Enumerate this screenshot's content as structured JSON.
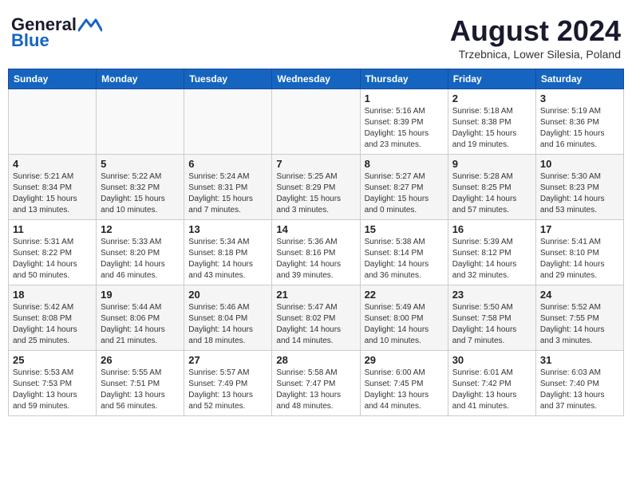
{
  "header": {
    "logo_general": "General",
    "logo_blue": "Blue",
    "month_year": "August 2024",
    "location": "Trzebnica, Lower Silesia, Poland"
  },
  "weekdays": [
    "Sunday",
    "Monday",
    "Tuesday",
    "Wednesday",
    "Thursday",
    "Friday",
    "Saturday"
  ],
  "weeks": [
    [
      {
        "day": "",
        "info": "",
        "empty": true
      },
      {
        "day": "",
        "info": "",
        "empty": true
      },
      {
        "day": "",
        "info": "",
        "empty": true
      },
      {
        "day": "",
        "info": "",
        "empty": true
      },
      {
        "day": "1",
        "info": "Sunrise: 5:16 AM\nSunset: 8:39 PM\nDaylight: 15 hours\nand 23 minutes.",
        "empty": false
      },
      {
        "day": "2",
        "info": "Sunrise: 5:18 AM\nSunset: 8:38 PM\nDaylight: 15 hours\nand 19 minutes.",
        "empty": false
      },
      {
        "day": "3",
        "info": "Sunrise: 5:19 AM\nSunset: 8:36 PM\nDaylight: 15 hours\nand 16 minutes.",
        "empty": false
      }
    ],
    [
      {
        "day": "4",
        "info": "Sunrise: 5:21 AM\nSunset: 8:34 PM\nDaylight: 15 hours\nand 13 minutes.",
        "empty": false
      },
      {
        "day": "5",
        "info": "Sunrise: 5:22 AM\nSunset: 8:32 PM\nDaylight: 15 hours\nand 10 minutes.",
        "empty": false
      },
      {
        "day": "6",
        "info": "Sunrise: 5:24 AM\nSunset: 8:31 PM\nDaylight: 15 hours\nand 7 minutes.",
        "empty": false
      },
      {
        "day": "7",
        "info": "Sunrise: 5:25 AM\nSunset: 8:29 PM\nDaylight: 15 hours\nand 3 minutes.",
        "empty": false
      },
      {
        "day": "8",
        "info": "Sunrise: 5:27 AM\nSunset: 8:27 PM\nDaylight: 15 hours\nand 0 minutes.",
        "empty": false
      },
      {
        "day": "9",
        "info": "Sunrise: 5:28 AM\nSunset: 8:25 PM\nDaylight: 14 hours\nand 57 minutes.",
        "empty": false
      },
      {
        "day": "10",
        "info": "Sunrise: 5:30 AM\nSunset: 8:23 PM\nDaylight: 14 hours\nand 53 minutes.",
        "empty": false
      }
    ],
    [
      {
        "day": "11",
        "info": "Sunrise: 5:31 AM\nSunset: 8:22 PM\nDaylight: 14 hours\nand 50 minutes.",
        "empty": false
      },
      {
        "day": "12",
        "info": "Sunrise: 5:33 AM\nSunset: 8:20 PM\nDaylight: 14 hours\nand 46 minutes.",
        "empty": false
      },
      {
        "day": "13",
        "info": "Sunrise: 5:34 AM\nSunset: 8:18 PM\nDaylight: 14 hours\nand 43 minutes.",
        "empty": false
      },
      {
        "day": "14",
        "info": "Sunrise: 5:36 AM\nSunset: 8:16 PM\nDaylight: 14 hours\nand 39 minutes.",
        "empty": false
      },
      {
        "day": "15",
        "info": "Sunrise: 5:38 AM\nSunset: 8:14 PM\nDaylight: 14 hours\nand 36 minutes.",
        "empty": false
      },
      {
        "day": "16",
        "info": "Sunrise: 5:39 AM\nSunset: 8:12 PM\nDaylight: 14 hours\nand 32 minutes.",
        "empty": false
      },
      {
        "day": "17",
        "info": "Sunrise: 5:41 AM\nSunset: 8:10 PM\nDaylight: 14 hours\nand 29 minutes.",
        "empty": false
      }
    ],
    [
      {
        "day": "18",
        "info": "Sunrise: 5:42 AM\nSunset: 8:08 PM\nDaylight: 14 hours\nand 25 minutes.",
        "empty": false
      },
      {
        "day": "19",
        "info": "Sunrise: 5:44 AM\nSunset: 8:06 PM\nDaylight: 14 hours\nand 21 minutes.",
        "empty": false
      },
      {
        "day": "20",
        "info": "Sunrise: 5:46 AM\nSunset: 8:04 PM\nDaylight: 14 hours\nand 18 minutes.",
        "empty": false
      },
      {
        "day": "21",
        "info": "Sunrise: 5:47 AM\nSunset: 8:02 PM\nDaylight: 14 hours\nand 14 minutes.",
        "empty": false
      },
      {
        "day": "22",
        "info": "Sunrise: 5:49 AM\nSunset: 8:00 PM\nDaylight: 14 hours\nand 10 minutes.",
        "empty": false
      },
      {
        "day": "23",
        "info": "Sunrise: 5:50 AM\nSunset: 7:58 PM\nDaylight: 14 hours\nand 7 minutes.",
        "empty": false
      },
      {
        "day": "24",
        "info": "Sunrise: 5:52 AM\nSunset: 7:55 PM\nDaylight: 14 hours\nand 3 minutes.",
        "empty": false
      }
    ],
    [
      {
        "day": "25",
        "info": "Sunrise: 5:53 AM\nSunset: 7:53 PM\nDaylight: 13 hours\nand 59 minutes.",
        "empty": false
      },
      {
        "day": "26",
        "info": "Sunrise: 5:55 AM\nSunset: 7:51 PM\nDaylight: 13 hours\nand 56 minutes.",
        "empty": false
      },
      {
        "day": "27",
        "info": "Sunrise: 5:57 AM\nSunset: 7:49 PM\nDaylight: 13 hours\nand 52 minutes.",
        "empty": false
      },
      {
        "day": "28",
        "info": "Sunrise: 5:58 AM\nSunset: 7:47 PM\nDaylight: 13 hours\nand 48 minutes.",
        "empty": false
      },
      {
        "day": "29",
        "info": "Sunrise: 6:00 AM\nSunset: 7:45 PM\nDaylight: 13 hours\nand 44 minutes.",
        "empty": false
      },
      {
        "day": "30",
        "info": "Sunrise: 6:01 AM\nSunset: 7:42 PM\nDaylight: 13 hours\nand 41 minutes.",
        "empty": false
      },
      {
        "day": "31",
        "info": "Sunrise: 6:03 AM\nSunset: 7:40 PM\nDaylight: 13 hours\nand 37 minutes.",
        "empty": false
      }
    ]
  ]
}
